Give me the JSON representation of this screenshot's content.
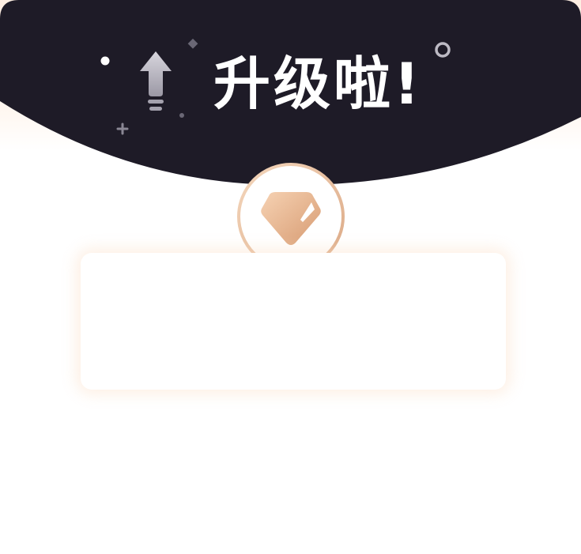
{
  "dialog": {
    "title": "升级啦!",
    "theme": {
      "header_background": "#1e1b27",
      "accent_gold_light": "#f2cba8",
      "accent_gold_dark": "#d9a47d",
      "glow": "#fde8d8"
    },
    "icons": {
      "upgrade": "arrow-up-icon",
      "badge": "diamond-icon"
    },
    "card": {}
  }
}
